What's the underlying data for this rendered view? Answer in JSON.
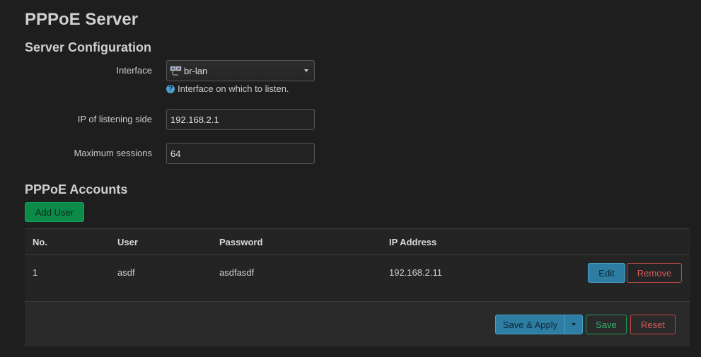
{
  "page": {
    "title": "PPPoE Server"
  },
  "server_config": {
    "title": "Server Configuration",
    "interface": {
      "label": "Interface",
      "value": "br-lan",
      "icon": "network-bridge-icon",
      "hint": "Interface on which to listen."
    },
    "listening_ip": {
      "label": "IP of listening side",
      "value": "192.168.2.1"
    },
    "max_sessions": {
      "label": "Maximum sessions",
      "value": "64"
    }
  },
  "accounts": {
    "title": "PPPoE Accounts",
    "add_label": "Add User",
    "columns": [
      "No.",
      "User",
      "Password",
      "IP Address"
    ],
    "rows": [
      {
        "no": "1",
        "user": "asdf",
        "password": "asdfasdf",
        "ip": "192.168.2.11"
      }
    ],
    "edit_label": "Edit",
    "remove_label": "Remove"
  },
  "footer": {
    "save_apply_label": "Save & Apply",
    "save_label": "Save",
    "reset_label": "Reset"
  },
  "colors": {
    "background": "#1e1e1e",
    "accent_blue": "#2e7da3",
    "accent_green": "#0b8a4a",
    "danger_red": "#c54a4a"
  }
}
